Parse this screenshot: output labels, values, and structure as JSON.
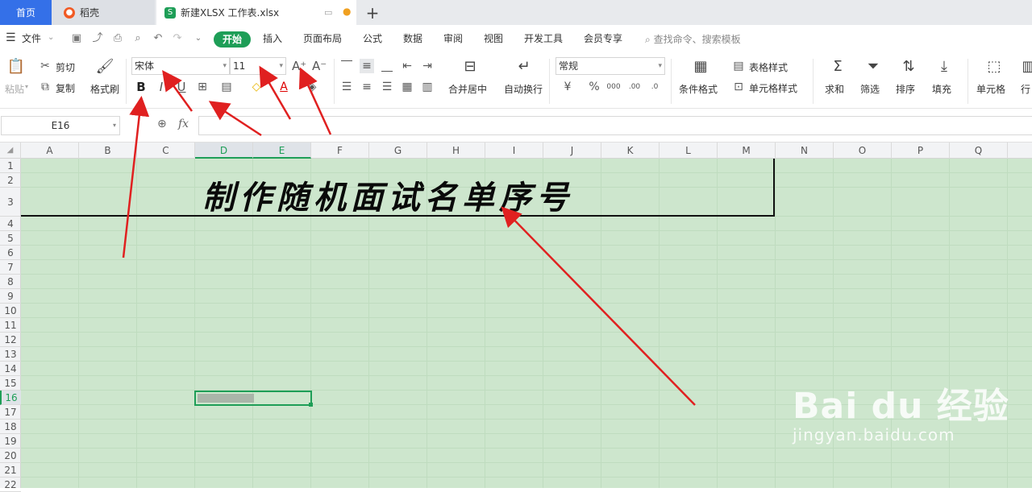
{
  "tabs": {
    "home": "首页",
    "daoke": "稻壳",
    "file": "新建XLSX 工作表.xlsx",
    "new_tab": "+"
  },
  "menu": {
    "file": "文件",
    "start": "开始",
    "items": [
      "插入",
      "页面布局",
      "公式",
      "数据",
      "审阅",
      "视图",
      "开发工具",
      "会员专享"
    ],
    "search": "查找命令、搜索模板"
  },
  "ribbon": {
    "paste": "粘贴",
    "cut": "剪切",
    "copy": "复制",
    "format_painter": "格式刷",
    "font_name": "宋体",
    "font_size": "11",
    "merge_center": "合并居中",
    "auto_wrap": "自动换行",
    "number_format": "常规",
    "table_style": "表格样式",
    "cell_style": "单元格样式",
    "cond_format": "条件格式",
    "sum": "求和",
    "filter": "筛选",
    "sort": "排序",
    "fill": "填充",
    "cell": "单元格",
    "row_col": "行"
  },
  "formula_bar": {
    "name_box": "E16",
    "fx": "fx",
    "content": ""
  },
  "columns": [
    "A",
    "B",
    "C",
    "D",
    "E",
    "F",
    "G",
    "H",
    "I",
    "J",
    "K",
    "L",
    "M",
    "N",
    "O",
    "P",
    "Q"
  ],
  "rows": [
    "1",
    "2",
    "3",
    "4",
    "5",
    "6",
    "7",
    "8",
    "9",
    "10",
    "11",
    "12",
    "13",
    "14",
    "15",
    "16",
    "17",
    "18",
    "19",
    "20",
    "21",
    "22"
  ],
  "sheet": {
    "title_text": "制作随机面试名单序号"
  },
  "watermark": {
    "main": "Bai du 经验",
    "sub": "jingyan.baidu.com"
  },
  "colors": {
    "accent": "#1e9e57",
    "home_tab": "#3470e8",
    "grid_bg": "#cde6cd",
    "arrow": "#e02020"
  }
}
